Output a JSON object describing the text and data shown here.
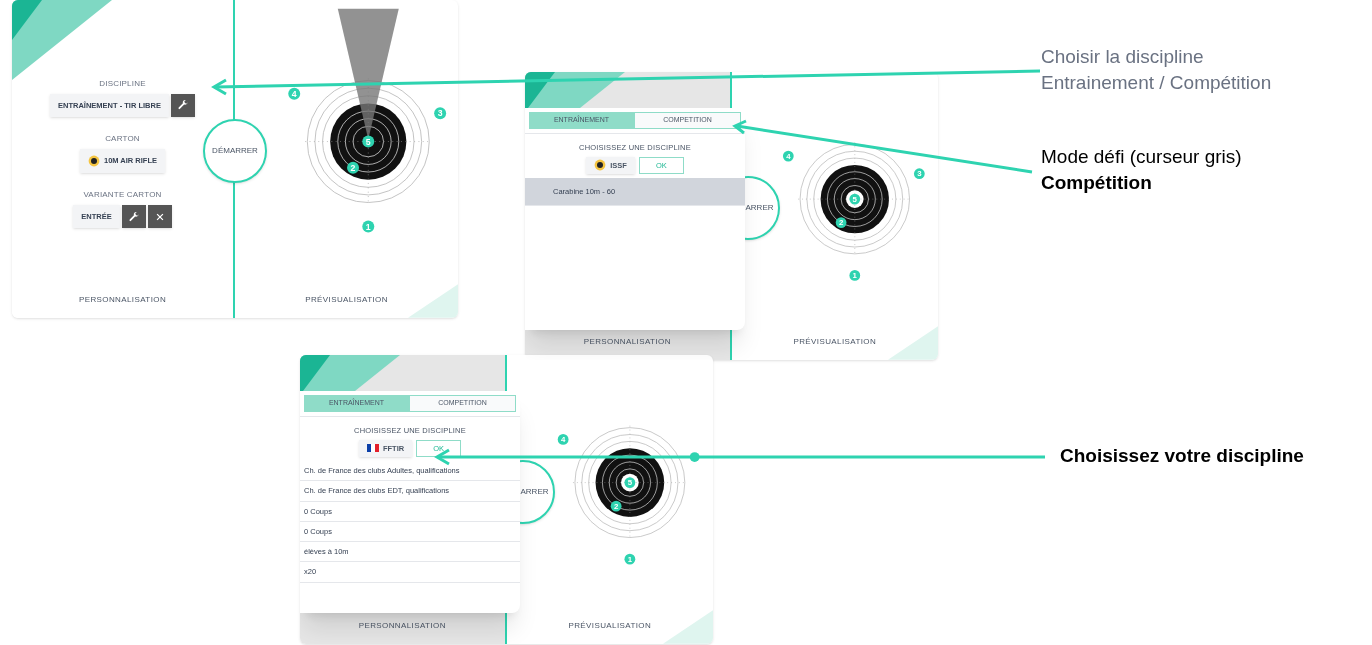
{
  "screenshots": [
    {
      "start_button": "DÉMARRER",
      "left_footer": "PERSONNALISATION",
      "right_footer": "PRÉVISUALISATION",
      "cursor": true,
      "markers": [
        "4",
        "3",
        "5",
        "2",
        "1"
      ],
      "fields": [
        {
          "label": "DISCIPLINE",
          "value": "ENTRAÎNEMENT - TIR LIBRE",
          "logo": false,
          "actions": [
            {
              "kind": "edit"
            }
          ]
        },
        {
          "label": "CARTON",
          "value": "10M AIR RIFLE",
          "logo": true
        },
        {
          "label": "VARIANTE CARTON",
          "value": "ENTRÉE",
          "logo": false,
          "actions": [
            {
              "kind": "edit"
            },
            {
              "kind": "clear"
            }
          ]
        }
      ]
    },
    {
      "start_button": "ARRER",
      "left_footer": "PERSONNALISATION",
      "right_footer": "PRÉVISUALISATION",
      "cursor": false,
      "markers": [
        "4",
        "3",
        "5",
        "2",
        "1"
      ],
      "modal": {
        "tabs": [
          {
            "label": "ENTRAÎNEMENT",
            "selected": true
          },
          {
            "label": "COMPETITION",
            "selected": false
          }
        ],
        "title": "CHOISISSEZ UNE DISCIPLINE",
        "federation": {
          "label": "ISSF",
          "kind": "target"
        },
        "ok": "OK",
        "items": [
          {
            "label": "Carabine 10m - 60",
            "selected": true
          }
        ]
      }
    },
    {
      "start_button": "ARRER",
      "left_footer": "PERSONNALISATION",
      "right_footer": "PRÉVISUALISATION",
      "cursor": false,
      "markers": [
        "4",
        "5",
        "2",
        "1"
      ],
      "modal": {
        "tabs": [
          {
            "label": "ENTRAÎNEMENT",
            "selected": true
          },
          {
            "label": "COMPETITION",
            "selected": false
          }
        ],
        "title": "CHOISISSEZ UNE DISCIPLINE",
        "federation": {
          "label": "FFTIR",
          "kind": "france"
        },
        "ok": "OK",
        "items": [
          {
            "label": "Ch. de France des clubs Adultes, qualifications",
            "selected": false
          },
          {
            "label": "Ch. de France des clubs EDT, qualifications",
            "selected": false
          },
          {
            "label": "0 Coups",
            "selected": false
          },
          {
            "label": "0 Coups",
            "selected": false
          },
          {
            "label": "élèves à 10m",
            "selected": false
          },
          {
            "label": "x20",
            "selected": false
          }
        ]
      }
    }
  ],
  "annotations": [
    {
      "lines": [
        {
          "text": "Choisir la discipline",
          "bold": false,
          "muted": true
        },
        {
          "text": "Entrainement / Compétition",
          "bold": false,
          "muted": true
        }
      ]
    },
    {
      "lines": [
        {
          "text": "Mode défi (curseur gris)",
          "bold": false,
          "muted": false
        },
        {
          "text": "Compétition",
          "bold": true,
          "muted": false
        }
      ]
    },
    {
      "lines": [
        {
          "text": "Choisissez votre discipline",
          "bold": true,
          "muted": false
        }
      ]
    }
  ]
}
